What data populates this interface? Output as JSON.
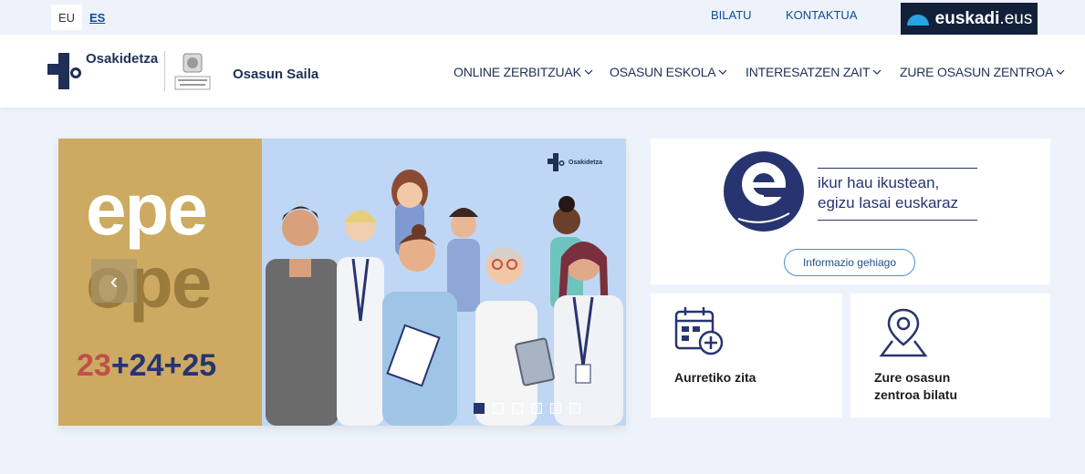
{
  "topbar": {
    "languages": [
      {
        "code": "EU",
        "active": true
      },
      {
        "code": "ES",
        "active": false
      }
    ],
    "links": [
      "BILATU",
      "KONTAKTUA"
    ],
    "portal": {
      "bold": "euskadi",
      "suffix": ".eus"
    }
  },
  "header": {
    "brand": "Osakidetza",
    "department": "Osasun Saila",
    "nav": [
      {
        "label": "ONLINE ZERBITZUAK"
      },
      {
        "label": "OSASUN ESKOLA"
      },
      {
        "label": "INTERESATZEN ZAIT"
      },
      {
        "label": "ZURE OSASUN ZENTROA"
      }
    ]
  },
  "hero": {
    "title_top": "epe",
    "title_bottom": "ope",
    "years_red": "23",
    "years_blue": "+24+25",
    "brand_small": "Osakidetza",
    "slides_total": 6,
    "slide_active": 1,
    "prev_glyph": "‹"
  },
  "euskaraz": {
    "line1": "ikur hau ikustean,",
    "line2": "egizu lasai euskaraz",
    "button": "Informazio gehiago"
  },
  "cards": [
    {
      "label": "Aurretiko zita",
      "icon": "calendar-add-icon"
    },
    {
      "label_line1": "Zure osasun",
      "label_line2": "zentroa bilatu",
      "icon": "map-pin-icon"
    }
  ],
  "colors": {
    "brand_navy": "#1f2f56",
    "link_blue": "#0f4c96",
    "hero_gold": "#ccaa62",
    "hero_blue_bg": "#bfd7f4",
    "page_bg": "#eef3fb"
  }
}
